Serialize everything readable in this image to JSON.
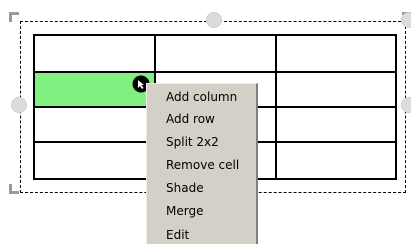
{
  "context_menu": {
    "items": [
      {
        "label": "Add column"
      },
      {
        "label": "Add row"
      },
      {
        "label": "Split 2x2"
      },
      {
        "label": "Remove cell"
      },
      {
        "label": "Shade"
      },
      {
        "label": "Merge"
      },
      {
        "label": "Edit"
      }
    ]
  },
  "table": {
    "rows": 4,
    "columns": 3,
    "shaded_cell": {
      "row": 2,
      "column": 1,
      "color": "#80f080"
    }
  },
  "colors": {
    "menu_background": "#d4d0c8",
    "handle": "#dcdcdc",
    "grid_line": "#000000"
  },
  "icons": {
    "cursor": "arrow-cursor-icon",
    "handles": "resize-handle-icon"
  }
}
